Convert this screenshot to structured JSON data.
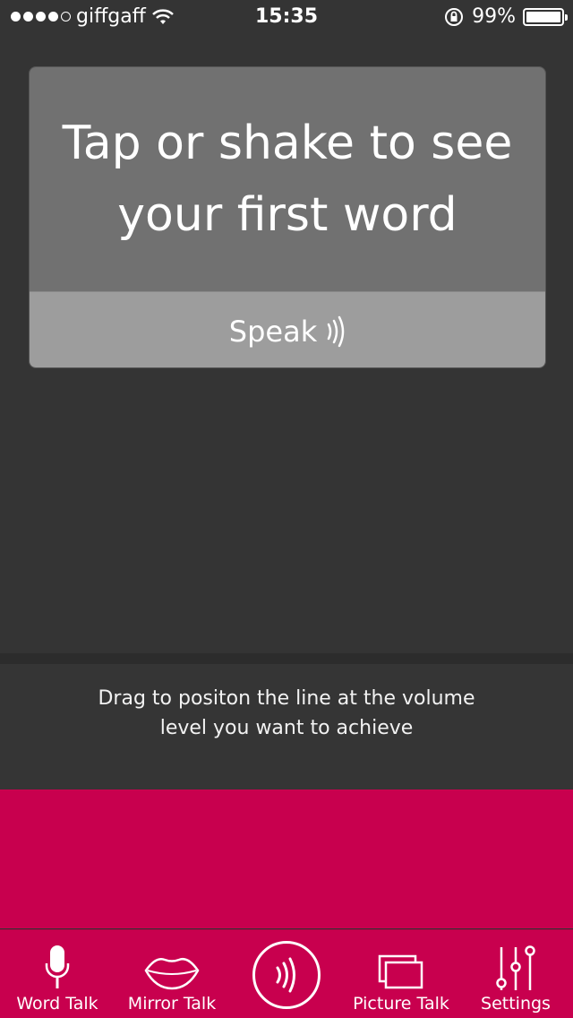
{
  "status_bar": {
    "carrier": "giffgaff",
    "time": "15:35",
    "battery": "99%",
    "signal_bars_filled": 4,
    "signal_bars_total": 5,
    "battery_level": 0.99,
    "icons": [
      "wifi-icon",
      "rotation-lock-icon",
      "battery-icon"
    ]
  },
  "card": {
    "prompt": "Tap or shake to see your first word",
    "speak_label": "Speak",
    "speak_icon": "sound-waves-icon"
  },
  "instructions": {
    "text": "Drag to positon the line at the volume level you want to achieve"
  },
  "tabs": [
    {
      "label": "Word Talk",
      "icon": "microphone-icon"
    },
    {
      "label": "Mirror Talk",
      "icon": "lips-icon"
    },
    {
      "label": "",
      "icon": "sound-waves-icon"
    },
    {
      "label": "Picture Talk",
      "icon": "pictures-icon"
    },
    {
      "label": "Settings",
      "icon": "sliders-icon"
    }
  ],
  "colors": {
    "background": "#343434",
    "card_top": "#717171",
    "card_bottom": "#9d9d9d",
    "accent": "#c8004e"
  }
}
